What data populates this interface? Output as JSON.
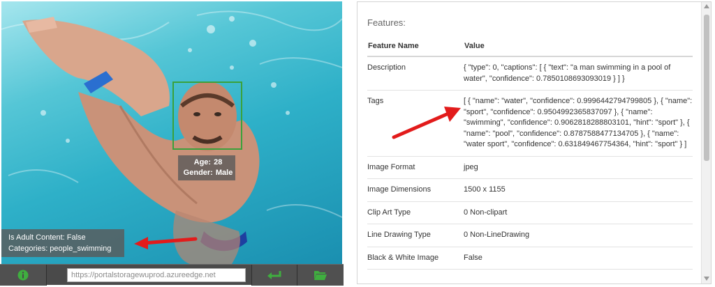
{
  "image_panel": {
    "face": {
      "age_label": "Age:",
      "age_value": "28",
      "gender_label": "Gender:",
      "gender_value": "Male"
    },
    "adult_content": "Is Adult Content: False",
    "categories": "Categories: people_swimming",
    "url_input_value": "https://portalstoragewuprod.azureedge.net"
  },
  "toolbar": {
    "info_icon": "info-icon",
    "submit_icon": "enter-arrow-icon",
    "folder_icon": "open-folder-icon"
  },
  "features": {
    "title": "Features:",
    "header_name": "Feature Name",
    "header_value": "Value",
    "rows": [
      {
        "name": "Description",
        "value": "{ \"type\": 0, \"captions\": [ { \"text\": \"a man swimming in a pool of water\", \"confidence\": 0.7850108693093019 } ] }"
      },
      {
        "name": "Tags",
        "value": "[ { \"name\": \"water\", \"confidence\": 0.9996442794799805 }, { \"name\": \"sport\", \"confidence\": 0.9504992365837097 }, { \"name\": \"swimming\", \"confidence\": 0.9062818288803101, \"hint\": \"sport\" }, { \"name\": \"pool\", \"confidence\": 0.8787588477134705 }, { \"name\": \"water sport\", \"confidence\": 0.631849467754364, \"hint\": \"sport\" } ]"
      },
      {
        "name": "Image Format",
        "value": "jpeg"
      },
      {
        "name": "Image Dimensions",
        "value": "1500 x 1155"
      },
      {
        "name": "Clip Art Type",
        "value": "0 Non-clipart"
      },
      {
        "name": "Line Drawing Type",
        "value": "0 Non-LineDrawing"
      },
      {
        "name": "Black & White Image",
        "value": "False"
      }
    ]
  },
  "colors": {
    "face_box": "#3aa13a",
    "annotation_arrow": "#e21b1b",
    "toolbar_icon": "#3fae3f",
    "toolbar_bg": "#4a4a4a"
  }
}
